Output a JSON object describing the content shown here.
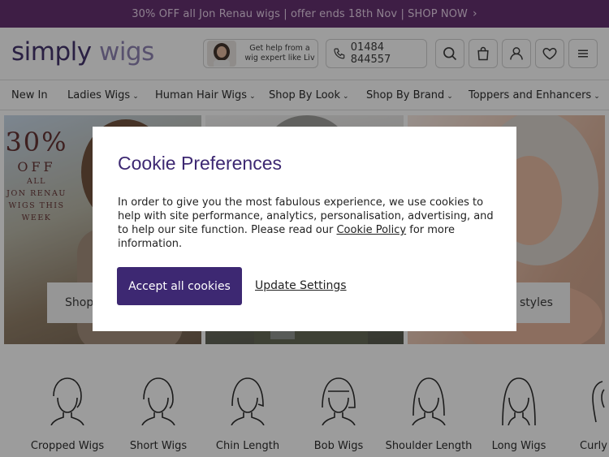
{
  "promo_bar": {
    "text": "30% OFF all Jon Renau wigs | offer ends 18th Nov | SHOP NOW",
    "chevron": "›"
  },
  "header": {
    "logo_primary": "simply",
    "logo_secondary": "wigs",
    "expert_text": "Get help from a wig expert like Liv",
    "phone": "01484 844557",
    "icons": [
      "search-icon",
      "bag-icon",
      "account-icon",
      "wishlist-heart-icon",
      "menu-icon"
    ]
  },
  "nav": {
    "items": [
      {
        "label": "New In",
        "caret": ""
      },
      {
        "label": "Ladies Wigs",
        "caret": "⌄"
      },
      {
        "label": "Human Hair Wigs",
        "caret": "⌄"
      },
      {
        "label": "Shop By Look",
        "caret": "⌄"
      },
      {
        "label": "Shop By Brand",
        "caret": "⌄"
      },
      {
        "label": "Toppers and Enhancers",
        "caret": "⌄"
      }
    ]
  },
  "hero": {
    "promo_big": "30%",
    "promo_off": "OFF",
    "promo_lines": [
      "ALL",
      "JON RENAU",
      "WIGS THIS",
      "WEEK"
    ],
    "left_button_partial": "Shop",
    "right_button_partial": "styles"
  },
  "styles": {
    "items": [
      {
        "label": "Cropped Wigs"
      },
      {
        "label": "Short Wigs"
      },
      {
        "label": "Chin Length"
      },
      {
        "label": "Bob Wigs"
      },
      {
        "label": "Shoulder Length"
      },
      {
        "label": "Long Wigs"
      },
      {
        "label": "Curly"
      }
    ]
  },
  "cookie_modal": {
    "title": "Cookie Preferences",
    "body_before_link": "In order to give you the most fabulous experience, we use cookies to help with site performance, analytics, personalisation, advertising, and to help our site function. Please read our ",
    "link_text": "Cookie Policy",
    "body_after_link": " for more information.",
    "accept_label": "Accept all cookies",
    "update_label": "Update Settings"
  },
  "colors": {
    "brand_purple": "#3d2872",
    "promo_bg": "#5d2769",
    "overlay": "rgba(20,20,20,0.42)"
  }
}
